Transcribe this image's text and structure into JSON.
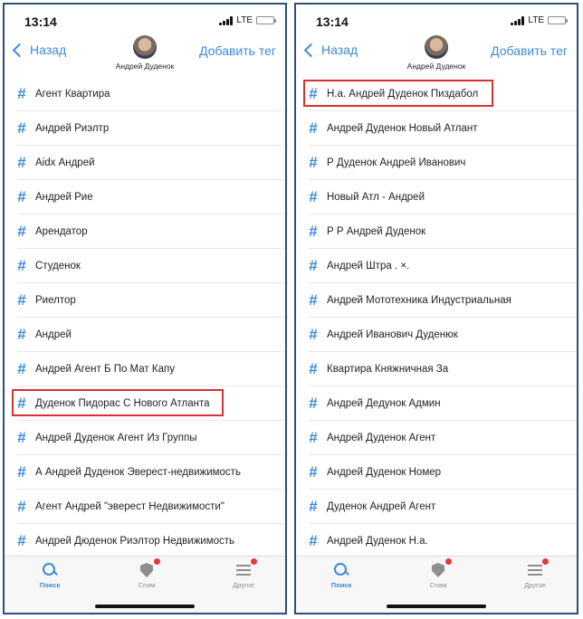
{
  "colors": {
    "accent": "#3b8ad9",
    "highlight_border": "#d9302f",
    "badge": "#e23a3a",
    "frame": "#2b4f7a"
  },
  "screens": [
    {
      "status": {
        "time": "13:14",
        "network": "LTE"
      },
      "nav": {
        "back_label": "Назад",
        "action_label": "Добавить тег",
        "contact_name": "Андрей Дуденок"
      },
      "tags": [
        "Агент Квартира",
        "Андрей Риэлтр",
        "Aidx Андрей",
        "Андрей Рие",
        "Арендатор",
        "Студенок",
        "Риелтор",
        "Андрей",
        "Андрей Агент Б По Мат Капу",
        "Дуденок Пидорас С Нового Атланта",
        "Андрей Дуденок Агент Из Группы",
        "А Андрей Дуденок Эверест-недвижимость",
        "Агент Андрей \"эверест Недвижимости\"",
        "Андрей Дюденок Риэлтор Недвижимость"
      ],
      "highlighted_tag": "Дуденок Пидорас С Нового Атланта",
      "tabbar": {
        "search": "Поиск",
        "spam": "Спам",
        "other": "Другое"
      }
    },
    {
      "status": {
        "time": "13:14",
        "network": "LTE"
      },
      "nav": {
        "back_label": "Назад",
        "action_label": "Добавить тег",
        "contact_name": "Андрей Дуденок"
      },
      "tags": [
        "Н.а. Андрей Дуденок Пиздабол",
        "Андрей Дуденок Новый Атлант",
        "Р Дуденок Андрей Иванович",
        "Новый Атл - Андрей",
        "Р Р Андрей Дуденок",
        "Андрей Штра . ×.",
        "Андрей Мототехника Индустриальная",
        "Андрей Иванович Дуденюк",
        "Квартира Княжничная За",
        "Андрей Дедунок Админ",
        "Андрей Дуденок Агент",
        "Андрей Дуденок Номер",
        "Дуденок Андрей Агент",
        "Андрей Дуденок Н.а."
      ],
      "highlighted_tag": "Н.а. Андрей Дуденок Пиздабол",
      "tabbar": {
        "search": "Поиск",
        "spam": "Спам",
        "other": "Другое"
      }
    }
  ]
}
